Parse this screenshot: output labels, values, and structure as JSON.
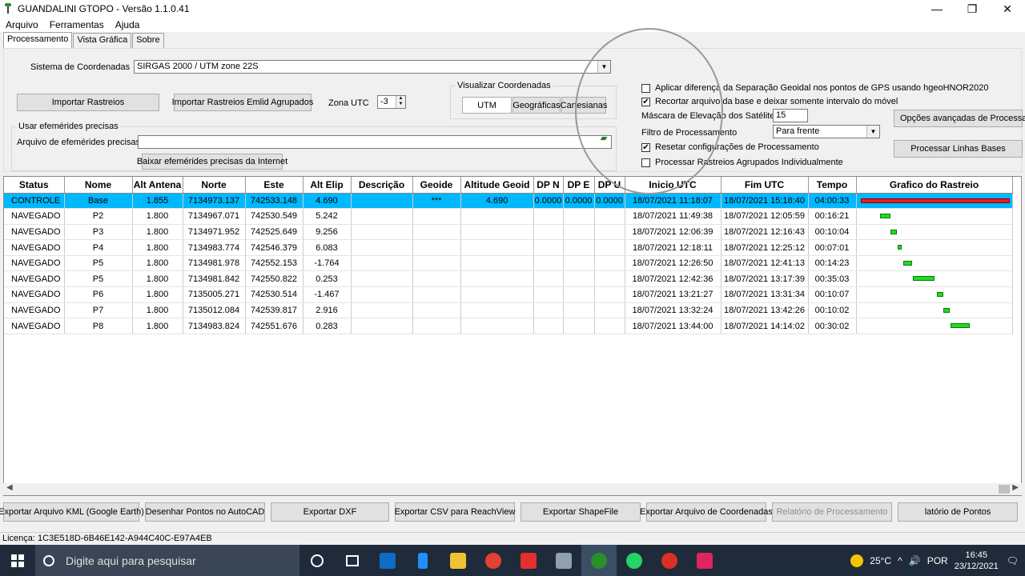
{
  "window": {
    "title": "GUANDALINI GTOPO - Versão 1.1.0.41",
    "minimize": "—",
    "restore": "❐",
    "close": "✕"
  },
  "menu": [
    "Arquivo",
    "Ferramentas",
    "Ajuda"
  ],
  "tabs": [
    "Processamento",
    "Vista Gráfica",
    "Sobre"
  ],
  "coords": {
    "label": "Sistema de Coordenadas",
    "value": "SIRGAS 2000 / UTM zone 22S"
  },
  "buttons": {
    "import": "Importar Rastreios",
    "import_emlid": "Importar Rastreios Emlid Agrupados",
    "download_ephem": "Baixar efemérides precisas da Internet",
    "advanced": "Opções avançadas de Processam",
    "process_baselines": "Processar Linhas Bases"
  },
  "zona_utc": {
    "label": "Zona UTC",
    "value": "-3"
  },
  "visualizar": {
    "title": "Visualizar Coordenadas",
    "options": [
      "UTM",
      "Geográficas",
      "Cartesianas"
    ]
  },
  "ephem": {
    "group": "Usar efemérides precisas",
    "label": "Arquivo de efemérides precisas",
    "value": ""
  },
  "options": {
    "geoid": "Aplicar diferença da Separação Geoidal nos pontos de GPS usando hgeoHNOR2020",
    "trim": "Recortar arquivo da base  e deixar somente intervalo do móvel",
    "mask_label": "Máscara de Elevação dos Satélites",
    "mask_value": "15",
    "filter_label": "Filtro de Processamento",
    "filter_value": "Para frente",
    "reset": "Resetar configurações de  Processamento",
    "individual": "Processar Rastreios Agrupados Individualmente",
    "check_mark": "✔"
  },
  "table": {
    "columns": [
      "Status",
      "Nome",
      "Alt Antena",
      "Norte",
      "Este",
      "Alt Elip",
      "Descrição",
      "Geoide",
      "Altitude Geoid",
      "DP N",
      "DP E",
      "DP U",
      "Inicio UTC",
      "Fim UTC",
      "Tempo",
      "Grafico do Rastreio"
    ],
    "rows": [
      {
        "status": "CONTROLE",
        "nome": "Base",
        "ant": "1.855",
        "norte": "7134973.137",
        "este": "742533.148",
        "elip": "4.690",
        "desc": "",
        "geoide": "***",
        "altgeoid": "4.690",
        "dpn": "0.0000",
        "dpe": "0.0000",
        "dpu": "0.0000",
        "inicio": "18/07/2021 11:18:07",
        "fim": "18/07/2021 15:18:40",
        "tempo": "04:00:33"
      },
      {
        "status": "NAVEGADO",
        "nome": "P2",
        "ant": "1.800",
        "norte": "7134967.071",
        "este": "742530.549",
        "elip": "5.242",
        "desc": "",
        "geoide": "",
        "altgeoid": "",
        "dpn": "",
        "dpe": "",
        "dpu": "",
        "inicio": "18/07/2021 11:49:38",
        "fim": "18/07/2021 12:05:59",
        "tempo": "00:16:21"
      },
      {
        "status": "NAVEGADO",
        "nome": "P3",
        "ant": "1.800",
        "norte": "7134971.952",
        "este": "742525.649",
        "elip": "9.256",
        "desc": "",
        "geoide": "",
        "altgeoid": "",
        "dpn": "",
        "dpe": "",
        "dpu": "",
        "inicio": "18/07/2021 12:06:39",
        "fim": "18/07/2021 12:16:43",
        "tempo": "00:10:04"
      },
      {
        "status": "NAVEGADO",
        "nome": "P4",
        "ant": "1.800",
        "norte": "7134983.774",
        "este": "742546.379",
        "elip": "6.083",
        "desc": "",
        "geoide": "",
        "altgeoid": "",
        "dpn": "",
        "dpe": "",
        "dpu": "",
        "inicio": "18/07/2021 12:18:11",
        "fim": "18/07/2021 12:25:12",
        "tempo": "00:07:01"
      },
      {
        "status": "NAVEGADO",
        "nome": "P5",
        "ant": "1.800",
        "norte": "7134981.978",
        "este": "742552.153",
        "elip": "-1.764",
        "desc": "",
        "geoide": "",
        "altgeoid": "",
        "dpn": "",
        "dpe": "",
        "dpu": "",
        "inicio": "18/07/2021 12:26:50",
        "fim": "18/07/2021 12:41:13",
        "tempo": "00:14:23"
      },
      {
        "status": "NAVEGADO",
        "nome": "P5",
        "ant": "1.800",
        "norte": "7134981.842",
        "este": "742550.822",
        "elip": "0.253",
        "desc": "",
        "geoide": "",
        "altgeoid": "",
        "dpn": "",
        "dpe": "",
        "dpu": "",
        "inicio": "18/07/2021 12:42:36",
        "fim": "18/07/2021 13:17:39",
        "tempo": "00:35:03"
      },
      {
        "status": "NAVEGADO",
        "nome": "P6",
        "ant": "1.800",
        "norte": "7135005.271",
        "este": "742530.514",
        "elip": "-1.467",
        "desc": "",
        "geoide": "",
        "altgeoid": "",
        "dpn": "",
        "dpe": "",
        "dpu": "",
        "inicio": "18/07/2021 13:21:27",
        "fim": "18/07/2021 13:31:34",
        "tempo": "00:10:07"
      },
      {
        "status": "NAVEGADO",
        "nome": "P7",
        "ant": "1.800",
        "norte": "7135012.084",
        "este": "742539.817",
        "elip": "2.916",
        "desc": "",
        "geoide": "",
        "altgeoid": "",
        "dpn": "",
        "dpe": "",
        "dpu": "",
        "inicio": "18/07/2021 13:32:24",
        "fim": "18/07/2021 13:42:26",
        "tempo": "00:10:02"
      },
      {
        "status": "NAVEGADO",
        "nome": "P8",
        "ant": "1.800",
        "norte": "7134983.824",
        "este": "742551.676",
        "elip": "0.283",
        "desc": "",
        "geoide": "",
        "altgeoid": "",
        "dpn": "",
        "dpe": "",
        "dpu": "",
        "inicio": "18/07/2021 13:44:00",
        "fim": "18/07/2021 14:14:02",
        "tempo": "00:30:02"
      }
    ]
  },
  "bottom_buttons": [
    {
      "label": "Exportar Arquivo KML (Google Earth)",
      "enabled": true
    },
    {
      "label": "Desenhar Pontos no AutoCAD",
      "enabled": true
    },
    {
      "label": "Exportar DXF",
      "enabled": true
    },
    {
      "label": "Exportar CSV para ReachView",
      "enabled": true
    },
    {
      "label": "Exportar ShapeFile",
      "enabled": true
    },
    {
      "label": "Exportar Arquivo de Coordenadas",
      "enabled": true
    },
    {
      "label": "Relatório de Processamento",
      "enabled": false
    },
    {
      "label": "latório de Pontos",
      "enabled": true
    }
  ],
  "status": "Licença: 1C3E518D-6B46E142-A944C40C-E97A4EB",
  "taskbar": {
    "search_placeholder": "Digite aqui para pesquisar",
    "temp": "25°C",
    "lang": "POR",
    "time": "16:45",
    "date": "23/12/2021",
    "tray_up": "^",
    "tray_volume": "🔊",
    "tray_notify": "🗨"
  }
}
